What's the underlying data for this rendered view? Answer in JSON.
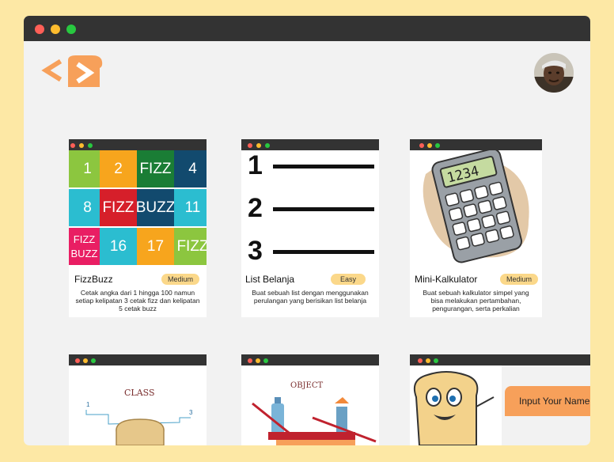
{
  "app": {
    "logo_name": "code-toast-logo",
    "avatar_name": "user-avatar"
  },
  "window": {
    "dot_colors": [
      "#ff5f57",
      "#febc2e",
      "#28c840"
    ]
  },
  "accent": "#f7a05a",
  "badge_color": "#fbd88a",
  "projects": [
    {
      "title": "FizzBuzz",
      "level": "Medium",
      "description": "Cetak angka dari 1 hingga 100 namun setiap kelipatan 3 cetak fizz dan kelipatan 5 cetak buzz",
      "grid": [
        "1",
        "2",
        "FIZZ",
        "4",
        "8",
        "FIZZ",
        "BUZZ",
        "11",
        "FIZZ BUZZ",
        "16",
        "17",
        "FIZZ"
      ]
    },
    {
      "title": "List Belanja",
      "level": "Easy",
      "description": "Buat sebuah list dengan menggunakan perulangan yang berisikan list belanja",
      "numbers": [
        "1",
        "2",
        "3"
      ]
    },
    {
      "title": "Mini-Kalkulator",
      "level": "Medium",
      "description": "Buat sebuah kalkulator simpel yang bisa melakukan pertambahan, pengurangan, serta perkalian",
      "display": "1234"
    },
    {
      "thumb_text": "CLASS",
      "marks": [
        "1",
        "3"
      ]
    },
    {
      "thumb_text": "OBJECT"
    },
    {
      "tooltip": "Input Your Name..."
    }
  ]
}
